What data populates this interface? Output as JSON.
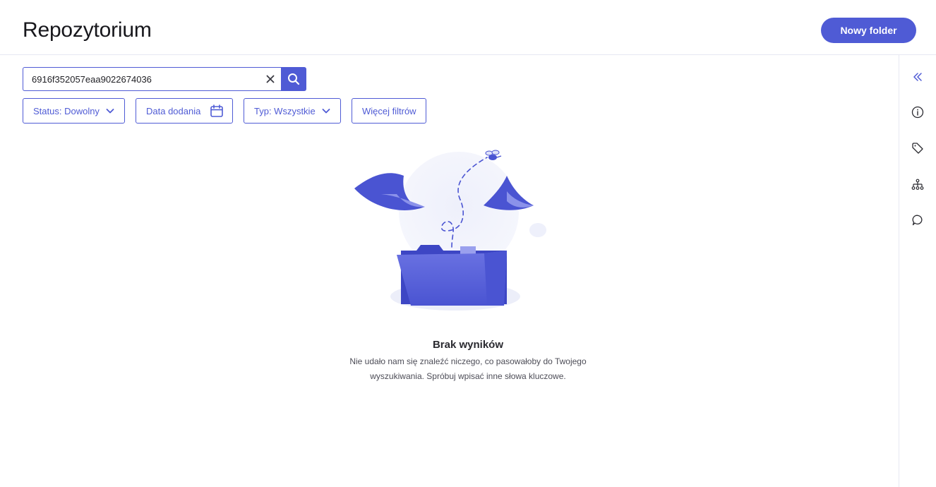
{
  "header": {
    "title": "Repozytorium",
    "new_folder_label": "Nowy folder"
  },
  "search": {
    "value": "6916f352057eaa9022674036"
  },
  "filters": [
    {
      "label": "Status: Dowolny",
      "icon": "chevron-down-icon"
    },
    {
      "label": "Data dodania",
      "icon": "calendar-icon"
    },
    {
      "label": "Typ: Wszystkie",
      "icon": "chevron-down-icon"
    },
    {
      "label": "Więcej filtrów"
    }
  ],
  "empty_state": {
    "title": "Brak wyników",
    "line1": "Nie udało nam się znaleźć niczego, co pasowałoby do Twojego",
    "line2": "wyszukiwania. Spróbuj wpisać inne słowa kluczowe."
  },
  "right_rail": [
    {
      "icon": "collapse-double-chevron-icon"
    },
    {
      "icon": "info-icon"
    },
    {
      "icon": "tag-icon"
    },
    {
      "icon": "hierarchy-icon"
    },
    {
      "icon": "comment-icon"
    }
  ],
  "colors": {
    "accent": "#4f5bd5",
    "divider": "#e6e8f2",
    "illustration_dark": "#4a54d2",
    "illustration_light": "#8b92ea"
  }
}
